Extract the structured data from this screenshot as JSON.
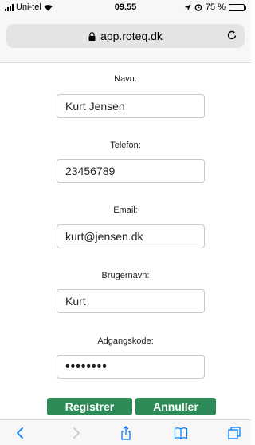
{
  "status_bar": {
    "carrier": "Uni-tel",
    "time": "09.55",
    "battery_label": "75 %",
    "battery_level": 0.75
  },
  "address_bar": {
    "url": "app.roteq.dk",
    "lock_icon": "lock-icon",
    "reload_icon": "reload-icon"
  },
  "form": {
    "name_label": "Navn:",
    "name_value": "Kurt Jensen",
    "phone_label": "Telefon:",
    "phone_value": "23456789",
    "email_label": "Email:",
    "email_value": "kurt@jensen.dk",
    "username_label": "Brugernavn:",
    "username_value": "Kurt",
    "password_label": "Adgangskode:",
    "password_value": "••••••••"
  },
  "buttons": {
    "register": "Registrer",
    "cancel": "Annuller"
  },
  "colors": {
    "button": "#2e8b57",
    "chrome": "#f7f7f7",
    "ios_blue": "#007aff"
  },
  "toolbar": {
    "icons": [
      "back-icon",
      "forward-icon",
      "share-icon",
      "bookmarks-icon",
      "tabs-icon"
    ]
  }
}
